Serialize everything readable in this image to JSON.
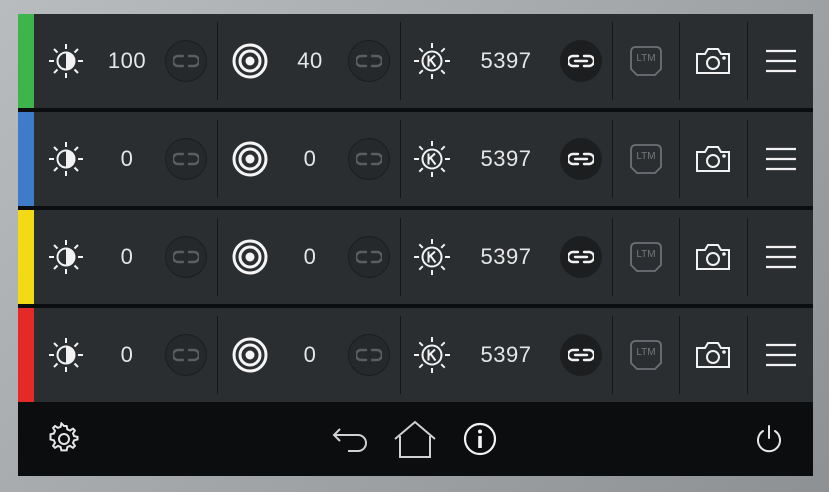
{
  "rows": [
    {
      "color": "#3db54a",
      "brightness": "100",
      "focus": "40",
      "color_temp": "5397",
      "brightness_linked": false,
      "focus_linked": false,
      "temp_linked": true,
      "ltm_label": "LTM"
    },
    {
      "color": "#3e7cc9",
      "brightness": "0",
      "focus": "0",
      "color_temp": "5397",
      "brightness_linked": false,
      "focus_linked": false,
      "temp_linked": true,
      "ltm_label": "LTM"
    },
    {
      "color": "#f3da17",
      "brightness": "0",
      "focus": "0",
      "color_temp": "5397",
      "brightness_linked": false,
      "focus_linked": false,
      "temp_linked": true,
      "ltm_label": "LTM"
    },
    {
      "color": "#e42a27",
      "brightness": "0",
      "focus": "0",
      "color_temp": "5397",
      "brightness_linked": false,
      "focus_linked": false,
      "temp_linked": true,
      "ltm_label": "LTM"
    }
  ],
  "icons": {
    "brightness": "brightness-icon",
    "focus": "focus-target-icon",
    "temperature": "kelvin-sun-icon",
    "link_off": "link-off-icon",
    "link_on": "link-on-icon",
    "ltm": "ltm-icon",
    "camera": "camera-icon",
    "menu": "hamburger-menu-icon"
  },
  "bottom_bar": {
    "settings": "gear-icon",
    "back": "back-arrow-icon",
    "home": "home-icon",
    "info": "info-icon",
    "power": "power-icon"
  }
}
